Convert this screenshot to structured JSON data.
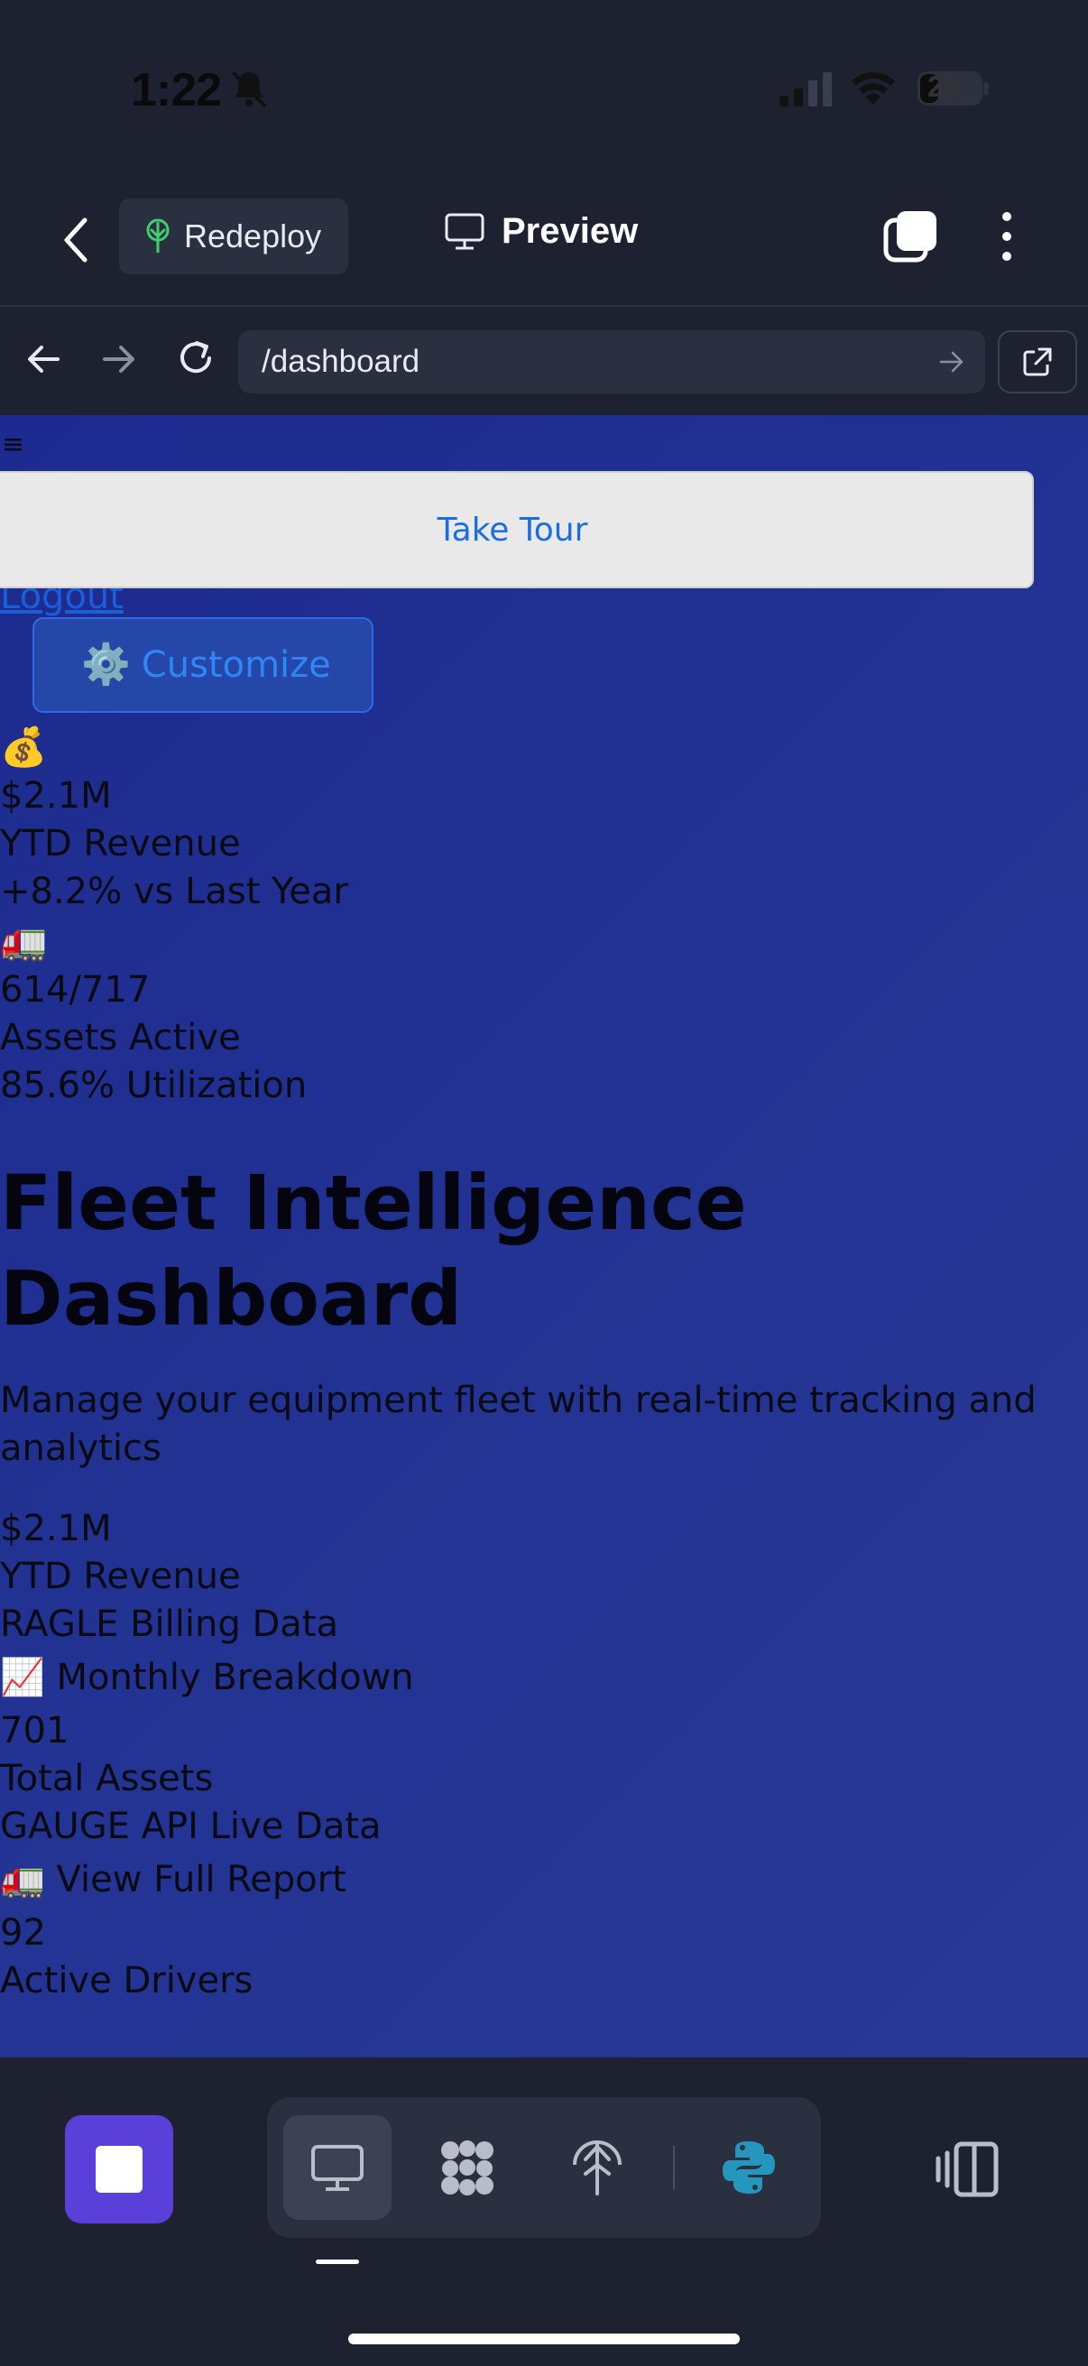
{
  "status": {
    "time": "1:22",
    "battery": "28"
  },
  "header": {
    "redeploy_label": "Redeploy",
    "preview_label": "Preview"
  },
  "browser": {
    "url": "/dashboard"
  },
  "page": {
    "menu_glyph": "≡",
    "tour_label": "Take Tour",
    "logout_label": "Logout",
    "customize_icon": "⚙️",
    "customize_label": "Customize",
    "kpi_revenue": {
      "icon": "💰",
      "value": "$2.1M",
      "label": "YTD Revenue",
      "change": "+8.2% vs Last Year"
    },
    "kpi_assets": {
      "icon": "🚛",
      "value": "614/717",
      "label": "Assets Active",
      "utilization": "85.6% Utilization"
    },
    "title": "Fleet Intelligence Dashboard",
    "subtitle": "Manage your equipment fleet with real-time tracking and analytics",
    "metrics": [
      {
        "value": "$2.1M",
        "label": "YTD Revenue",
        "source": "RAGLE Billing Data",
        "link": "📈 Monthly Breakdown"
      },
      {
        "value": "701",
        "label": "Total Assets",
        "source": "GAUGE API Live Data",
        "link": "🚛 View Full Report"
      },
      {
        "value": "92",
        "label": "Active Drivers"
      }
    ]
  },
  "colors": {
    "accent": "#5b3fd9",
    "link": "#1a6fe0",
    "python": "#2596be"
  }
}
